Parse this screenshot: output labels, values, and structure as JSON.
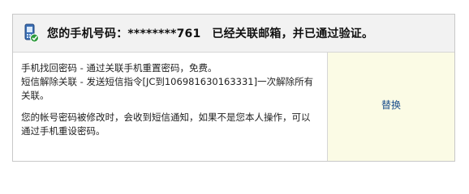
{
  "header": {
    "icon": "phone-check-icon",
    "label": "您的手机号码：",
    "number": "********761",
    "status": "已经关联邮箱，并已通过验证。"
  },
  "info": {
    "line1": "手机找回密码 - 通过关联手机重置密码，免费。",
    "line2": "短信解除关联 - 发送短信指令[JC到106981630163331]一次解除所有关联。",
    "line3": "您的帐号密码被修改时，会收到短信通知，如果不是您本人操作，可以通过手机重设密码。"
  },
  "actions": {
    "replace_label": "替换"
  },
  "colors": {
    "link": "#1a4e8c",
    "header_bg": "#f2f2f2",
    "action_bg": "#fbfbe5",
    "icon_accent": "#2e9a3c"
  }
}
